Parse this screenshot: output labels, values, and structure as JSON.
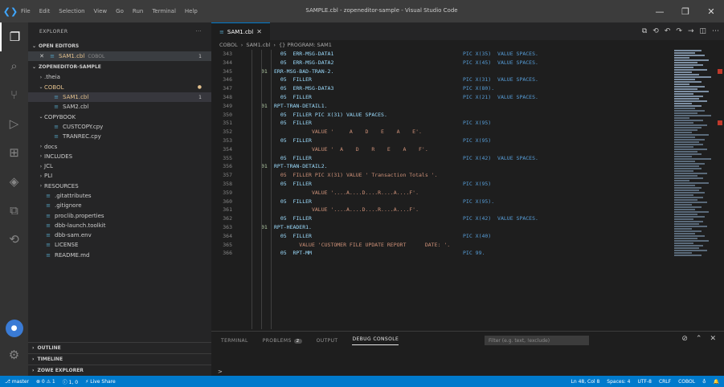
{
  "window": {
    "title": "SAMPLE.cbl - zopeneditor-sample - Visual Studio Code",
    "menu": [
      "File",
      "Edit",
      "Selection",
      "View",
      "Go",
      "Run",
      "Terminal",
      "Help"
    ],
    "controls": [
      "—",
      "❐",
      "✕"
    ]
  },
  "sidebar": {
    "header": "EXPLORER",
    "header_more": "···",
    "open_editors": {
      "title": "OPEN EDITORS",
      "file": "SAM1.cbl",
      "file_path": "COBOL",
      "badge": "1"
    },
    "workspace_title": "ZOPENEDITOR-SAMPLE",
    "tree": [
      {
        "twisty": "›",
        "icon": "",
        "label": ".theia",
        "badge": ""
      },
      {
        "twisty": "⌄",
        "icon": "",
        "label": "COBOL",
        "badge": "●",
        "dirty": true
      },
      {
        "twisty": "",
        "icon": "≡",
        "label": "SAM1.cbl",
        "badge": "1",
        "selected": true
      },
      {
        "twisty": "",
        "icon": "≡",
        "label": "SAM2.cbl",
        "badge": ""
      },
      {
        "twisty": "⌄",
        "icon": "",
        "label": "COPYBOOK",
        "badge": ""
      },
      {
        "twisty": "",
        "icon": "≡",
        "label": "CUSTCOPY.cpy",
        "badge": ""
      },
      {
        "twisty": "",
        "icon": "≡",
        "label": "TRANREC.cpy",
        "badge": ""
      },
      {
        "twisty": "›",
        "icon": "",
        "label": "docs",
        "badge": ""
      },
      {
        "twisty": "›",
        "icon": "",
        "label": "INCLUDES",
        "badge": ""
      },
      {
        "twisty": "›",
        "icon": "",
        "label": "JCL",
        "badge": ""
      },
      {
        "twisty": "›",
        "icon": "",
        "label": "PLI",
        "badge": ""
      },
      {
        "twisty": "›",
        "icon": "",
        "label": "RESOURCES",
        "badge": ""
      },
      {
        "twisty": "",
        "icon": "≡",
        "label": ".gitattributes",
        "badge": ""
      },
      {
        "twisty": "",
        "icon": "≡",
        "label": ".gitignore",
        "badge": ""
      },
      {
        "twisty": "",
        "icon": "≡",
        "label": "proclib.properties",
        "badge": ""
      },
      {
        "twisty": "",
        "icon": "≡",
        "label": "dbb-launch.toolkit",
        "badge": ""
      },
      {
        "twisty": "",
        "icon": "≡",
        "label": "dbb-sam.env",
        "badge": ""
      },
      {
        "twisty": "",
        "icon": "≡",
        "label": "LICENSE",
        "badge": ""
      },
      {
        "twisty": "",
        "icon": "≡",
        "label": "README.md",
        "badge": ""
      }
    ],
    "bottom_sections": [
      "OUTLINE",
      "TIMELINE",
      "ZOWE EXPLORER"
    ]
  },
  "editor": {
    "tab_label": "SAM1.cbl",
    "tab_close": "✕",
    "breadcrumb": [
      "COBOL",
      "SAM1.cbl",
      "{} PROGRAM: SAM1"
    ],
    "lines": [
      {
        "n": "343",
        "lvl": "",
        "text": "  05  ERR-MSG-DATA1",
        "pic": "PIC X(35)  VALUE SPACES."
      },
      {
        "n": "344",
        "lvl": "",
        "text": "  05  ERR-MSG-DATA2",
        "pic": "PIC X(45)  VALUE SPACES."
      },
      {
        "n": "345",
        "lvl": "01",
        "text": "ERR-MSG-BAD-TRAN-2.",
        "pic": ""
      },
      {
        "n": "346",
        "lvl": "",
        "text": "  05  FILLER",
        "pic": "PIC X(31)  VALUE SPACES."
      },
      {
        "n": "347",
        "lvl": "",
        "text": "  05  ERR-MSG-DATA3",
        "pic": "PIC X(80)."
      },
      {
        "n": "348",
        "lvl": "",
        "text": "  05  FILLER",
        "pic": "PIC X(21)  VALUE SPACES."
      },
      {
        "n": "349",
        "lvl": "01",
        "text": "RPT-TRAN-DETAIL1.",
        "pic": ""
      },
      {
        "n": "350",
        "lvl": "",
        "text": "  05  FILLER PIC X(31) VALUE SPACES.",
        "pic": ""
      },
      {
        "n": "351",
        "lvl": "",
        "text": "  05  FILLER",
        "pic": "PIC X(95)"
      },
      {
        "n": "352",
        "lvl": "",
        "text": "            VALUE '     A    D    E    A    E'.",
        "pic": ""
      },
      {
        "n": "353",
        "lvl": "",
        "text": "  05  FILLER",
        "pic": "PIC X(95)"
      },
      {
        "n": "354",
        "lvl": "",
        "text": "            VALUE '  A    D    R    E    A    F'.",
        "pic": ""
      },
      {
        "n": "355",
        "lvl": "",
        "text": "  05  FILLER",
        "pic": "PIC X(42)  VALUE SPACES."
      },
      {
        "n": "356",
        "lvl": "01",
        "text": "RPT-TRAN-DETAIL2.",
        "pic": ""
      },
      {
        "n": "357",
        "lvl": "",
        "text": "  05  FILLER PIC X(31) VALUE ' Transaction Totals '.",
        "pic": ""
      },
      {
        "n": "358",
        "lvl": "",
        "text": "  05  FILLER",
        "pic": "PIC X(95)"
      },
      {
        "n": "359",
        "lvl": "",
        "text": "            VALUE '....A....D....R....A....F'.",
        "pic": ""
      },
      {
        "n": "360",
        "lvl": "",
        "text": "  05  FILLER",
        "pic": "PIC X(95)."
      },
      {
        "n": "361",
        "lvl": "",
        "text": "            VALUE '....A....D....R....A....F'.",
        "pic": ""
      },
      {
        "n": "362",
        "lvl": "",
        "text": "  05  FILLER",
        "pic": "PIC X(42)  VALUE SPACES."
      },
      {
        "n": "363",
        "lvl": "01",
        "text": "RPT-HEADER1.",
        "pic": ""
      },
      {
        "n": "364",
        "lvl": "",
        "text": "  05  FILLER",
        "pic": "PIC X(40)"
      },
      {
        "n": "365",
        "lvl": "",
        "text": "        VALUE 'CUSTOMER FILE UPDATE REPORT      DATE: '.",
        "pic": ""
      },
      {
        "n": "366",
        "lvl": "",
        "text": "  05  RPT-MM",
        "pic": "PIC 99."
      }
    ]
  },
  "panel": {
    "tabs": [
      {
        "label": "TERMINAL",
        "count": "",
        "active": false
      },
      {
        "label": "PROBLEMS",
        "count": "2",
        "active": false
      },
      {
        "label": "OUTPUT",
        "count": "",
        "active": false
      },
      {
        "label": "DEBUG CONSOLE",
        "count": "",
        "active": true
      }
    ],
    "filter_placeholder": "Filter (e.g. text, !exclude)",
    "prompt": ">"
  },
  "statusbar": {
    "left": [
      "⎇ master",
      "⊗ 0 ⚠ 1",
      "ⓘ 1, 0",
      "⚡ Live Share"
    ],
    "right": [
      "Ln 48, Col 8",
      "Spaces: 4",
      "UTF-8",
      "CRLF",
      "COBOL",
      "♁",
      "🔔"
    ]
  },
  "colors": {
    "accent": "#007acc",
    "titlebar": "#3c3c3c",
    "activitybar": "#333333",
    "sidebar": "#252526",
    "editor": "#1e1e1e"
  }
}
